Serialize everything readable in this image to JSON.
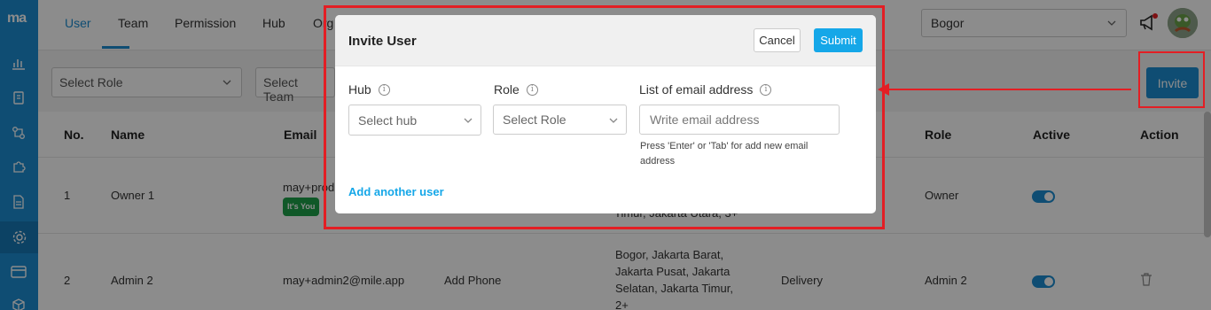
{
  "app": {
    "logo": "ma"
  },
  "sidebar": {
    "items": [
      {
        "icon": "chart-icon"
      },
      {
        "icon": "clipboard-icon"
      },
      {
        "icon": "flow-icon"
      },
      {
        "icon": "puzzle-icon"
      },
      {
        "icon": "document-icon"
      },
      {
        "icon": "gear-icon",
        "active": true
      },
      {
        "icon": "card-icon"
      },
      {
        "icon": "box-icon"
      }
    ]
  },
  "header": {
    "tabs": [
      {
        "label": "User",
        "active": true
      },
      {
        "label": "Team"
      },
      {
        "label": "Permission"
      },
      {
        "label": "Hub"
      },
      {
        "label": "Org"
      }
    ],
    "city_select": "Bogor"
  },
  "filters": {
    "role_placeholder": "Select Role",
    "team_placeholder": "Select Team",
    "invite_label": "Invite"
  },
  "table": {
    "headers": {
      "no": "No.",
      "name": "Name",
      "email": "Email",
      "role": "Role",
      "active": "Active",
      "action": "Action"
    },
    "rows": [
      {
        "no": "1",
        "name": "Owner 1",
        "email": "may+prod",
        "badge": "It's You",
        "hub": "Timur, Jakarta Utara, 3+",
        "role": "Owner",
        "active": true
      },
      {
        "no": "2",
        "name": "Admin 2",
        "email": "may+admin2@mile.app",
        "phone": "Add Phone",
        "hub_lines": [
          "Bogor, Jakarta Barat,",
          "Jakarta Pusat, Jakarta",
          "Selatan, Jakarta Timur,",
          "2+"
        ],
        "team": "Delivery",
        "role": "Admin 2",
        "active": true
      }
    ]
  },
  "modal": {
    "title": "Invite User",
    "cancel_label": "Cancel",
    "submit_label": "Submit",
    "hub_label": "Hub",
    "hub_placeholder": "Select hub",
    "role_label": "Role",
    "role_placeholder": "Select Role",
    "email_label": "List of email address",
    "email_placeholder": "Write email address",
    "email_hint": "Press 'Enter' or 'Tab' for add new email address",
    "add_another": "Add another user"
  },
  "colors": {
    "brand": "#1c8dd1",
    "submit": "#15a7e8",
    "annotation": "#e31e24",
    "badge": "#1ea04a"
  }
}
